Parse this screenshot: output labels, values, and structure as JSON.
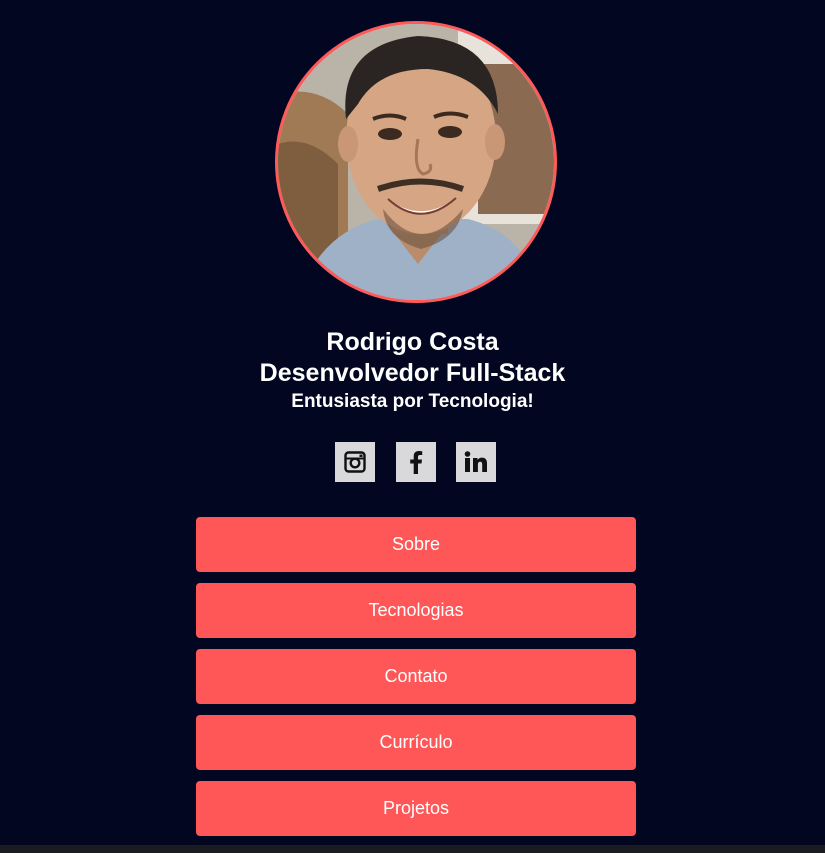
{
  "profile": {
    "name": "Rodrigo Costa",
    "role": "Desenvolvedor Full-Stack",
    "tagline": "Entusiasta por Tecnologia!"
  },
  "socials": [
    {
      "icon": "instagram-icon"
    },
    {
      "icon": "facebook-icon"
    },
    {
      "icon": "linkedin-icon"
    }
  ],
  "nav": {
    "items": [
      {
        "label": "Sobre"
      },
      {
        "label": "Tecnologias"
      },
      {
        "label": "Contato"
      },
      {
        "label": "Currículo"
      },
      {
        "label": "Projetos"
      }
    ]
  },
  "colors": {
    "background": "#020620",
    "accent": "#ff5757",
    "avatar_border": "#ff5a5a",
    "social_bg": "#d9d9dc"
  }
}
